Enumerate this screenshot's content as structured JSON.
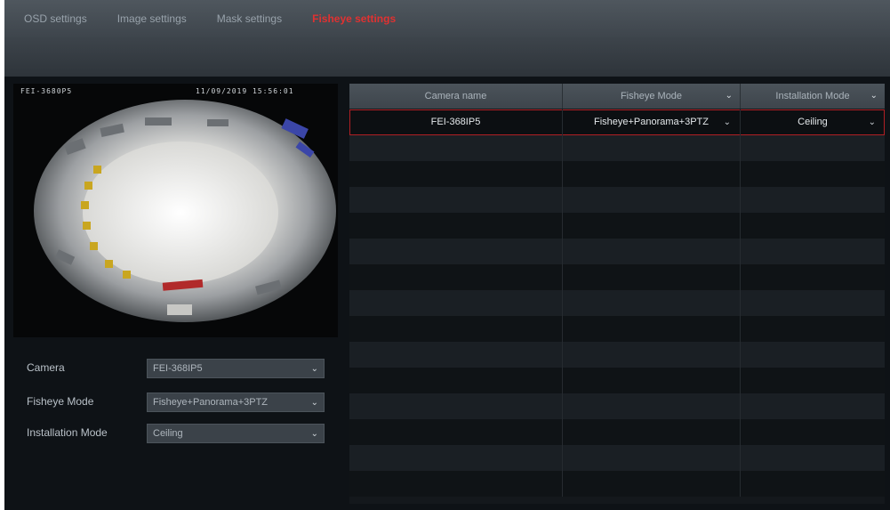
{
  "tabs": [
    {
      "label": "OSD settings",
      "active": false
    },
    {
      "label": "Image settings",
      "active": false
    },
    {
      "label": "Mask settings",
      "active": false
    },
    {
      "label": "Fisheye settings",
      "active": true
    }
  ],
  "preview": {
    "osd_name": "FEI-3680P5",
    "osd_time": "11/09/2019 15:56:01"
  },
  "form": {
    "camera_label": "Camera",
    "camera_value": "FEI-368IP5",
    "fisheye_mode_label": "Fisheye Mode",
    "fisheye_mode_value": "Fisheye+Panorama+3PTZ",
    "installation_mode_label": "Installation Mode",
    "installation_mode_value": "Ceiling"
  },
  "table": {
    "headers": {
      "camera_name": "Camera name",
      "fisheye_mode": "Fisheye Mode",
      "installation_mode": "Installation Mode"
    },
    "rows": [
      {
        "camera_name": "FEI-368IP5",
        "fisheye_mode": "Fisheye+Panorama+3PTZ",
        "installation_mode": "Ceiling"
      }
    ],
    "empty_rows": 14
  },
  "colors": {
    "accent_active_tab": "#e03131",
    "selection_border": "#b11f24"
  },
  "icons": {
    "dropdown": "chevron-down-icon"
  }
}
